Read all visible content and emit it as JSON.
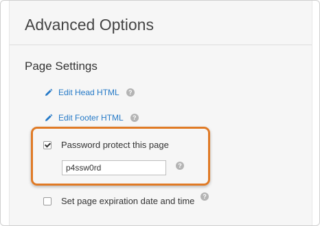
{
  "header": {
    "title": "Advanced Options"
  },
  "page_settings": {
    "section_title": "Page Settings",
    "edit_head_html": "Edit Head HTML",
    "edit_footer_html": "Edit Footer HTML",
    "password_protect": {
      "label": "Password protect this page",
      "checked": true,
      "value": "p4ssw0rd"
    },
    "expiration": {
      "label": "Set page expiration date and time",
      "checked": false
    },
    "help_glyph": "?"
  },
  "colors": {
    "link": "#2479c7",
    "highlight": "#e07a25"
  },
  "icons": {
    "edit": "pencil-icon",
    "help": "help-icon"
  }
}
